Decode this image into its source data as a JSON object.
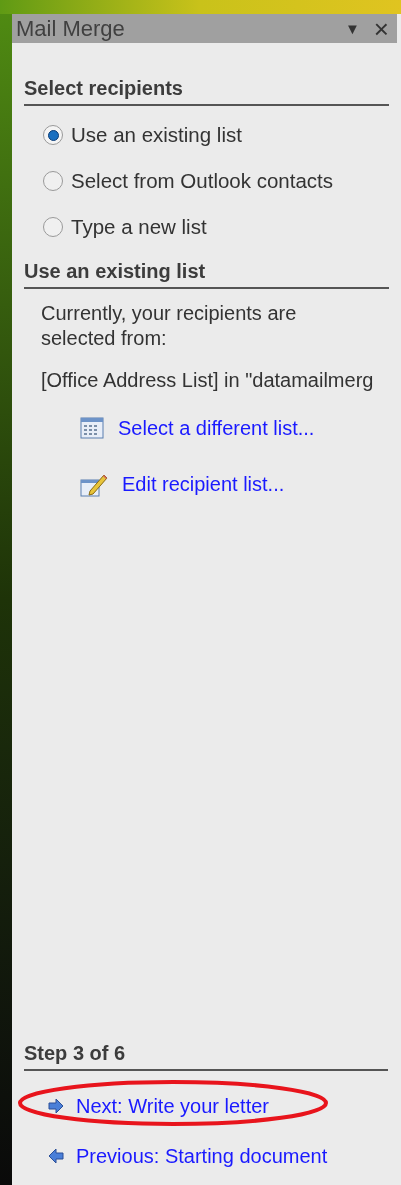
{
  "window": {
    "title": "Mail Merge",
    "menu_glyph": "▼",
    "close_glyph": "×"
  },
  "select_recipients": {
    "heading": "Select recipients",
    "options": [
      {
        "label": "Use an existing list",
        "selected": true
      },
      {
        "label": "Select from Outlook contacts",
        "selected": false
      },
      {
        "label": "Type a new list",
        "selected": false
      }
    ]
  },
  "existing_list": {
    "heading": "Use an existing list",
    "description": "Currently, your recipients are selected from:",
    "source": "[Office Address List] in \"datamailmerg",
    "links": [
      {
        "kind": "table",
        "label": "Select a different list..."
      },
      {
        "kind": "edit",
        "label": "Edit recipient list..."
      }
    ]
  },
  "step": {
    "heading": "Step 3 of 6",
    "links": [
      {
        "kind": "next",
        "label": "Next: Write your letter",
        "circled": true
      },
      {
        "kind": "previous",
        "label": "Previous: Starting document",
        "circled": false
      }
    ]
  }
}
